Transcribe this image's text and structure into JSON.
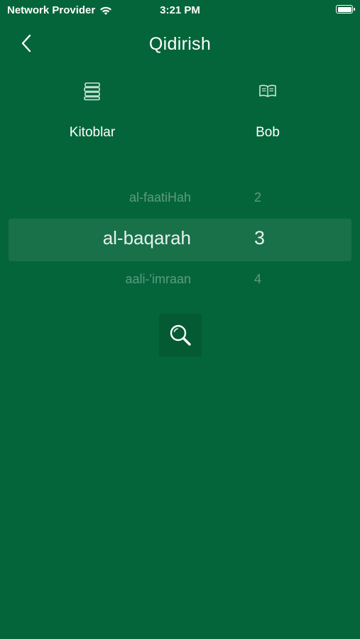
{
  "status_bar": {
    "carrier": "Network Provider",
    "time": "3:21 PM",
    "wifi_icon": "wifi-icon",
    "battery_icon": "battery-icon"
  },
  "nav": {
    "title": "Qidirish",
    "back_icon": "chevron-left-icon"
  },
  "tabs": [
    {
      "label": "Kitoblar",
      "icon": "books-stack-icon"
    },
    {
      "label": "Bob",
      "icon": "open-book-icon"
    }
  ],
  "picker": {
    "rows": [
      {
        "name": "al-faatiHah",
        "number": "2"
      },
      {
        "name": "al-baqarah",
        "number": "3"
      },
      {
        "name": "aali-'imraan",
        "number": "4"
      }
    ],
    "selected_index": 1
  },
  "search_button": {
    "icon": "search-icon"
  },
  "colors": {
    "background": "#05653a",
    "search_button_bg": "#035a33",
    "text": "#ffffff"
  }
}
